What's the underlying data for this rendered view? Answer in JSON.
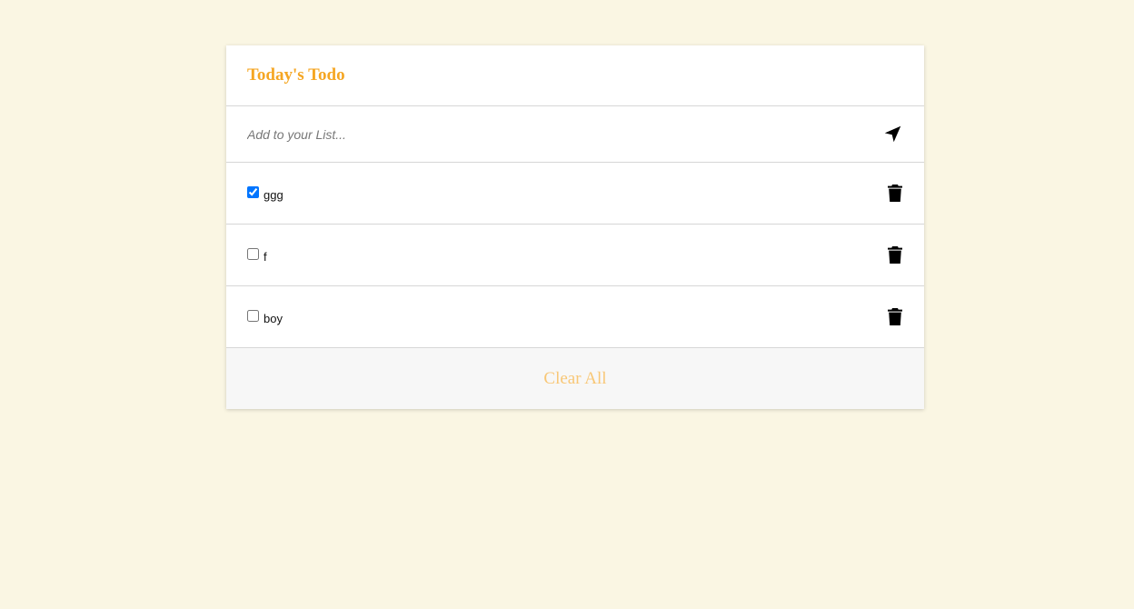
{
  "header": {
    "title": "Today's Todo"
  },
  "add": {
    "placeholder": "Add to your List...",
    "value": ""
  },
  "items": [
    {
      "label": "ggg",
      "checked": true
    },
    {
      "label": "f",
      "checked": false
    },
    {
      "label": "boy",
      "checked": false
    }
  ],
  "footer": {
    "clear_label": "Clear All"
  },
  "colors": {
    "background": "#faf6e3",
    "title": "#f5a623",
    "clear": "#f8c776",
    "checkbox": "#1a73e8"
  },
  "icons": {
    "send": "paper-plane-icon",
    "delete": "trash-icon"
  }
}
